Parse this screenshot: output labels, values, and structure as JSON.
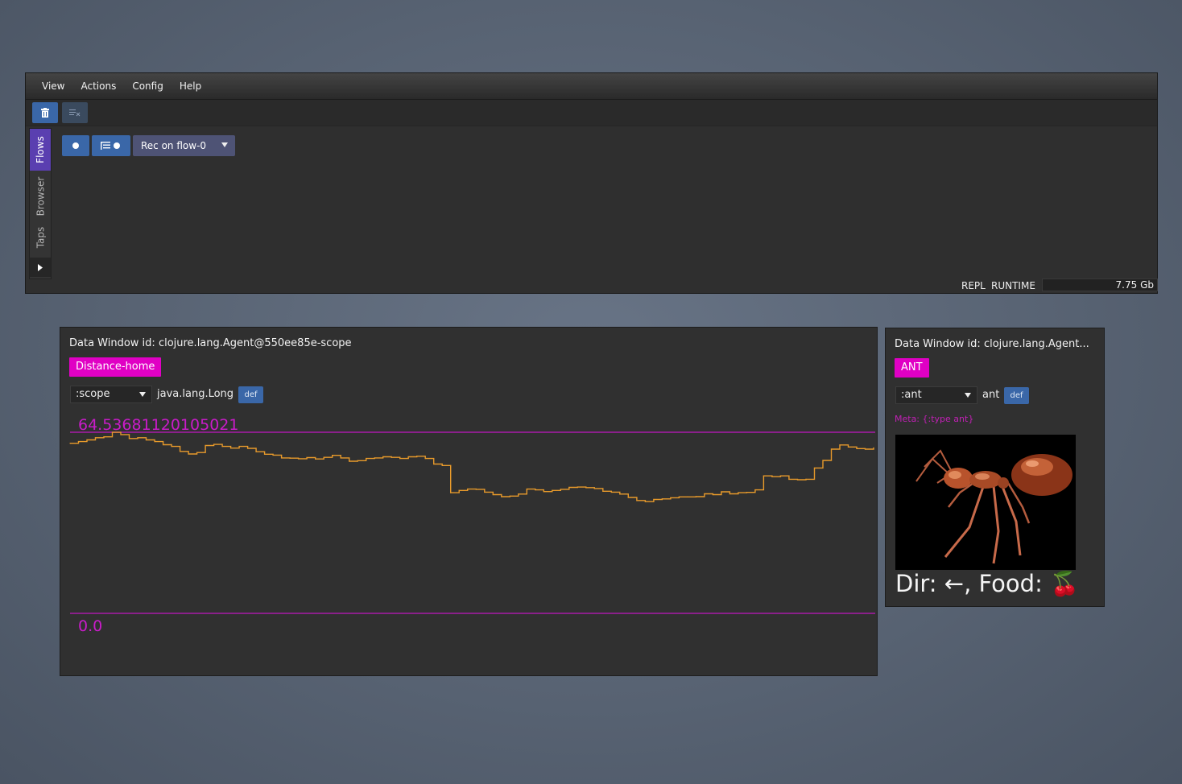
{
  "menubar": {
    "items": [
      "View",
      "Actions",
      "Config",
      "Help"
    ]
  },
  "toolbar": {
    "clear_icon": "trash-icon",
    "clear_filters_icon": "clear-filter-icon"
  },
  "side_tabs": {
    "flows": "Flows",
    "browser": "Browser",
    "taps": "Taps",
    "expand_icon": "triangle-right-icon"
  },
  "flows": {
    "record_icon": "record-dot-icon",
    "record_tree_icon": "tree-record-icon",
    "rec_select_value": "Rec on flow-0"
  },
  "status_bar": {
    "repl": "REPL",
    "runtime": "RUNTIME",
    "memory": "7.75 Gb"
  },
  "scope_window": {
    "title": "Data Window id: clojure.lang.Agent@550ee85e-scope",
    "tag": "Distance-home",
    "key_select": ":scope",
    "type": "java.lang.Long",
    "def_label": "def",
    "max_value": "64.53681120105021",
    "min_value": "0.0",
    "accent_color": "#c91cc9",
    "line_color": "#e89a2b"
  },
  "ant_window": {
    "title": "Data Window id: clojure.lang.Agent...",
    "tag": "ANT",
    "key_select": ":ant",
    "type": "ant",
    "def_label": "def",
    "meta": "Meta: {:type ant}",
    "status": "Dir: ←, Food: 🍒",
    "image_icon": "ant-image"
  },
  "chart_data": {
    "type": "line",
    "title": "",
    "xlabel": "",
    "ylabel": "",
    "ylim": [
      0,
      64.53681120105021
    ],
    "series": [
      {
        "values": [
          60.6,
          61.2,
          61.8,
          62.6,
          62.9,
          64.5,
          63.7,
          62.3,
          62.6,
          61.8,
          61.2,
          60.1,
          59.5,
          57.7,
          56.8,
          57.3,
          59.8,
          60.2,
          59.5,
          58.9,
          59.5,
          58.8,
          57.6,
          56.7,
          56.4,
          55.4,
          55.3,
          55.1,
          55.5,
          55.0,
          55.6,
          56.3,
          55.4,
          54.2,
          54.4,
          55.2,
          55.4,
          55.8,
          55.6,
          55.2,
          55.8,
          56.0,
          55.2,
          53.2,
          52.7,
          43.0,
          43.8,
          44.3,
          44.2,
          43.2,
          42.3,
          41.6,
          41.8,
          42.5,
          44.3,
          44.0,
          43.4,
          43.8,
          44.2,
          44.9,
          45.0,
          44.8,
          44.5,
          43.5,
          43.2,
          42.5,
          41.3,
          40.2,
          39.8,
          40.6,
          40.8,
          41.2,
          41.5,
          41.5,
          41.6,
          42.6,
          42.3,
          43.3,
          42.6,
          43.0,
          43.1,
          44.0,
          49.0,
          48.7,
          49.0,
          47.8,
          47.6,
          47.8,
          51.8,
          54.5,
          58.5,
          60.0,
          59.3,
          58.7,
          58.5,
          59.0
        ]
      }
    ]
  }
}
